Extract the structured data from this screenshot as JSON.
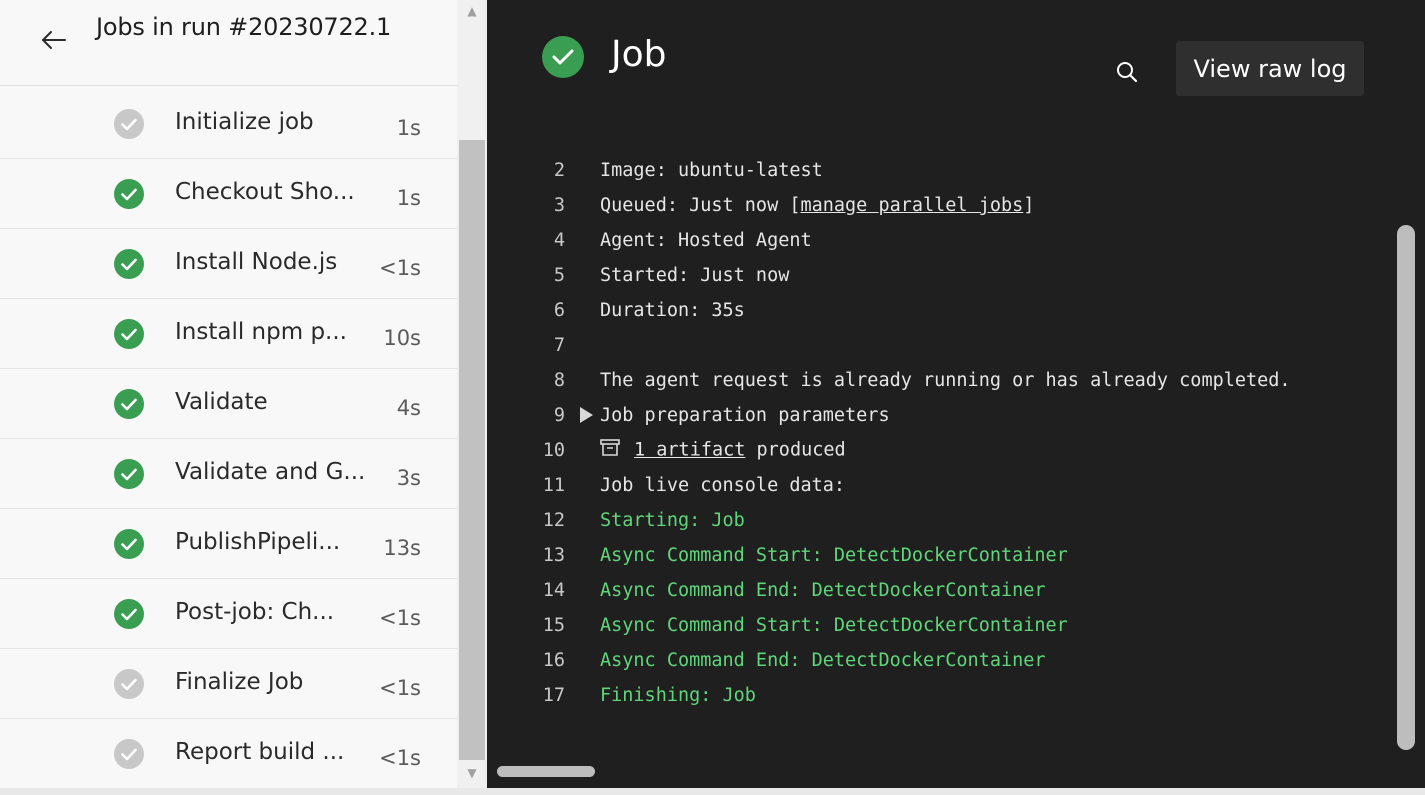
{
  "run": {
    "title": "Jobs in run #20230722.1",
    "back_icon": "arrow-left-icon"
  },
  "steps": [
    {
      "name": "Initialize job",
      "duration": "1s",
      "status": "skipped"
    },
    {
      "name": "Checkout Sho...",
      "duration": "1s",
      "status": "succeeded"
    },
    {
      "name": "Install Node.js",
      "duration": "<1s",
      "status": "succeeded"
    },
    {
      "name": "Install npm p...",
      "duration": "10s",
      "status": "succeeded"
    },
    {
      "name": "Validate",
      "duration": "4s",
      "status": "succeeded"
    },
    {
      "name": "Validate and G...",
      "duration": "3s",
      "status": "succeeded"
    },
    {
      "name": "PublishPipeli...",
      "duration": "13s",
      "status": "succeeded"
    },
    {
      "name": "Post-job: Ch...",
      "duration": "<1s",
      "status": "succeeded"
    },
    {
      "name": "Finalize Job",
      "duration": "<1s",
      "status": "skipped"
    },
    {
      "name": "Report build ...",
      "duration": "<1s",
      "status": "skipped"
    }
  ],
  "job": {
    "title": "Job",
    "status": "succeeded",
    "view_raw_log_label": "View raw log",
    "search_icon": "search-icon"
  },
  "log": {
    "lines": [
      {
        "num": "2",
        "text": "Image: ubuntu-latest",
        "color": "default"
      },
      {
        "num": "3",
        "text_before": "Queued: Just now [",
        "link": "manage parallel jobs",
        "text_after": "]",
        "color": "default"
      },
      {
        "num": "4",
        "text": "Agent: Hosted Agent",
        "color": "default"
      },
      {
        "num": "5",
        "text": "Started: Just now",
        "color": "default"
      },
      {
        "num": "6",
        "text": "Duration: 35s",
        "color": "default"
      },
      {
        "num": "7",
        "text": "",
        "color": "default"
      },
      {
        "num": "8",
        "text": "The agent request is already running or has already completed.",
        "color": "default"
      },
      {
        "num": "9",
        "text": "Job preparation parameters",
        "color": "default",
        "expander": true
      },
      {
        "num": "10",
        "link": "1 artifact",
        "text_after": " produced",
        "color": "default",
        "artifact": true
      },
      {
        "num": "11",
        "text": "Job live console data:",
        "color": "default"
      },
      {
        "num": "12",
        "text": "Starting: Job",
        "color": "green"
      },
      {
        "num": "13",
        "text": "Async Command Start: DetectDockerContainer",
        "color": "green"
      },
      {
        "num": "14",
        "text": "Async Command End: DetectDockerContainer",
        "color": "green"
      },
      {
        "num": "15",
        "text": "Async Command Start: DetectDockerContainer",
        "color": "green"
      },
      {
        "num": "16",
        "text": "Async Command End: DetectDockerContainer",
        "color": "green"
      },
      {
        "num": "17",
        "text": "Finishing: Job",
        "color": "green"
      }
    ]
  },
  "colors": {
    "success": "#3a9e52",
    "skipped": "#c8c8c8",
    "log_bg": "#1f1f1f",
    "log_green": "#5fd67a"
  }
}
